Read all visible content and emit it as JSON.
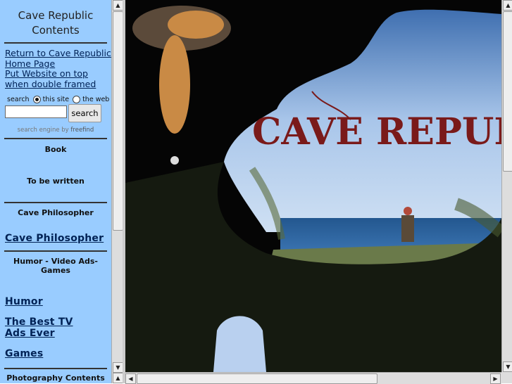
{
  "left_frame": {
    "title": "Cave Republic Contents",
    "links_top": [
      "Return to Cave Republic Home Page",
      "Put Website on top when double framed"
    ],
    "search": {
      "label": "search",
      "option_site": "this site",
      "option_web": "the web",
      "selected": "this site",
      "input_value": "",
      "button_label": "search",
      "powered_by_prefix": "search engine by",
      "powered_by_name": "freefind"
    },
    "sections": {
      "book_header": "Book",
      "book_text": "To be written",
      "philosopher_header": "Cave Philosopher",
      "philosopher_link": "Cave Philosopher",
      "humor_header": "Humor - Video Ads- Games",
      "humor_link": "Humor",
      "tv_link": "The Best TV Ads Ever",
      "games_link": "Games",
      "photo_header": "Photography Contents"
    }
  },
  "right_frame": {
    "banner_text": "CAVE REPUBLI"
  },
  "colors": {
    "left_bg": "#99ccff",
    "link": "#002255",
    "banner_text": "#7a1a1a",
    "sky": "#9fbfe6",
    "sea": "#2a5f9a"
  },
  "icons": {
    "up": "triangle-up-icon",
    "down": "triangle-down-icon",
    "left": "triangle-left-icon",
    "right": "triangle-right-icon"
  }
}
